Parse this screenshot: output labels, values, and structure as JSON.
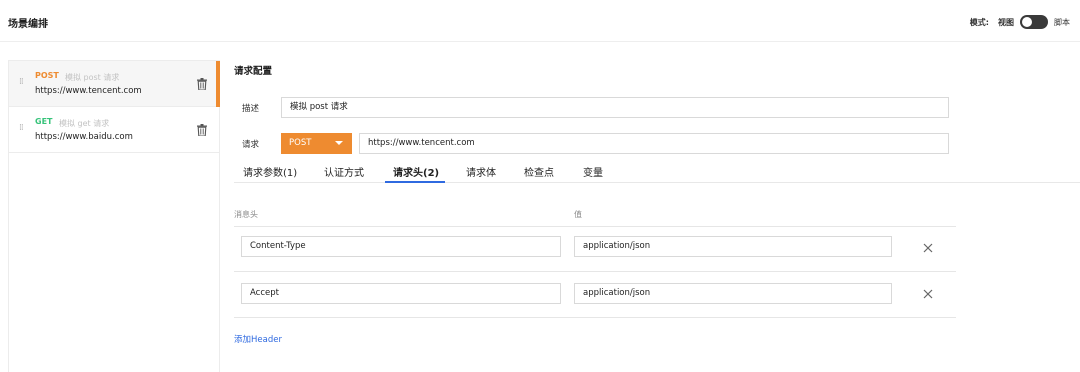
{
  "header": {
    "title": "场景编排",
    "mode_label": "模式:",
    "view_label": "视图",
    "script_label": "脚本"
  },
  "sidebar": {
    "items": [
      {
        "method": "POST",
        "method_color": "#ee8b30",
        "desc": "模拟 post 请求",
        "url": "https://www.tencent.com",
        "active": true
      },
      {
        "method": "GET",
        "method_color": "#37c37a",
        "desc": "模拟 get 请求",
        "url": "https://www.baidu.com",
        "active": false
      }
    ]
  },
  "main": {
    "section_title": "请求配置",
    "desc_label": "描述",
    "desc_value": "模拟 post 请求",
    "request_label": "请求",
    "method_value": "POST",
    "url_value": "https://www.tencent.com",
    "tabs": [
      {
        "label": "请求参数(1)",
        "active": false
      },
      {
        "label": "认证方式",
        "active": false
      },
      {
        "label": "请求头(2)",
        "active": true
      },
      {
        "label": "请求体",
        "active": false
      },
      {
        "label": "检查点",
        "active": false
      },
      {
        "label": "变量",
        "active": false
      }
    ],
    "headers_table": {
      "columns": [
        "消息头",
        "值"
      ],
      "rows": [
        {
          "key": "Content-Type",
          "value": "application/json"
        },
        {
          "key": "Accept",
          "value": "application/json"
        }
      ]
    },
    "add_header_label": "添加Header"
  },
  "colors": {
    "accent_orange": "#ee8b30",
    "get_green": "#37c37a",
    "link_blue": "#2f6ae0"
  }
}
